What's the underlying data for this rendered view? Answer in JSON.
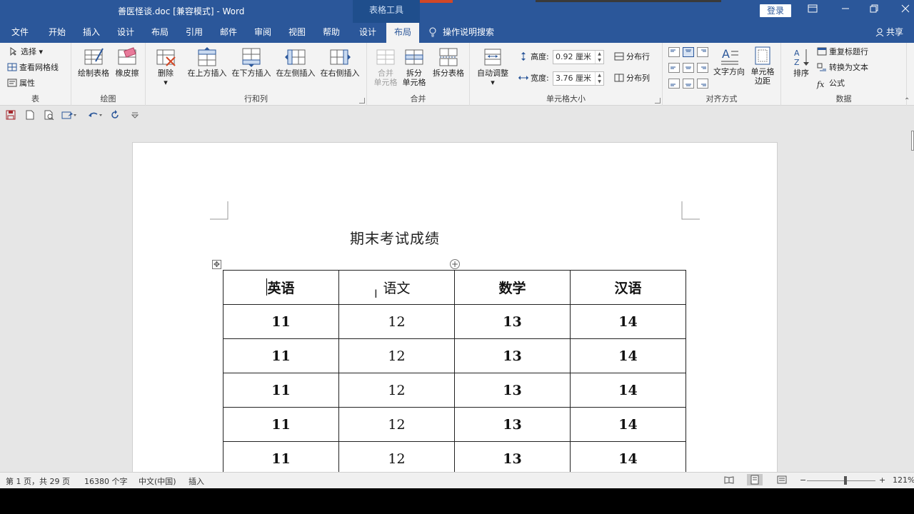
{
  "titlebar": {
    "title": "善医怪谈.doc [兼容模式]  -  Word",
    "table_tools": "表格工具",
    "login": "登录",
    "ribbon_display_icon": "ribbon-display-icon",
    "minimize_icon": "minimize-icon",
    "restore_icon": "restore-icon",
    "close_icon": "close-icon"
  },
  "tabs": [
    "文件",
    "开始",
    "插入",
    "设计",
    "布局",
    "引用",
    "邮件",
    "审阅",
    "视图",
    "帮助",
    "设计",
    "布局"
  ],
  "active_tab_index": 11,
  "tellme": "操作说明搜索",
  "share": "共享",
  "ribbon": {
    "table": {
      "label": "表",
      "select": "选择",
      "view_gridlines": "查看网格线",
      "properties": "属性"
    },
    "draw": {
      "label": "绘图",
      "draw_table": "绘制表格",
      "eraser": "橡皮擦"
    },
    "rows_cols": {
      "label": "行和列",
      "delete": "删除",
      "insert_above": "在上方插入",
      "insert_below": "在下方插入",
      "insert_left": "在左侧插入",
      "insert_right": "在右侧插入"
    },
    "merge": {
      "label": "合并",
      "merge_cells_1": "合并",
      "merge_cells_2": "单元格",
      "split_cells_1": "拆分",
      "split_cells_2": "单元格",
      "split_table": "拆分表格"
    },
    "cell_size": {
      "label": "单元格大小",
      "autofit": "自动调整",
      "height_label": "高度:",
      "height_value": "0.92 厘米",
      "width_label": "宽度:",
      "width_value": "3.76 厘米",
      "distribute_rows": "分布行",
      "distribute_cols": "分布列"
    },
    "alignment": {
      "label": "对齐方式",
      "text_direction": "文字方向",
      "cell_margins_1": "单元格",
      "cell_margins_2": "边距"
    },
    "data": {
      "label": "数据",
      "sort": "排序",
      "repeat_header": "重复标题行",
      "convert_text": "转换为文本",
      "formula": "公式"
    }
  },
  "document": {
    "title": "期末考试成绩",
    "table": {
      "headers": [
        "英语",
        "语文",
        "数学",
        "汉语"
      ],
      "rows": [
        [
          "11",
          "12",
          "13",
          "14"
        ],
        [
          "11",
          "12",
          "13",
          "14"
        ],
        [
          "11",
          "12",
          "13",
          "14"
        ],
        [
          "11",
          "12",
          "13",
          "14"
        ],
        [
          "11",
          "12",
          "13",
          "14"
        ]
      ]
    }
  },
  "status": {
    "page": "第 1 页，共 29 页",
    "words": "16380 个字",
    "language": "中文(中国)",
    "mode": "插入",
    "zoom": "121%",
    "zoom_minus": "−",
    "zoom_plus": "+"
  },
  "colors": {
    "brand": "#2b579a",
    "accent_red": "#d24726"
  }
}
